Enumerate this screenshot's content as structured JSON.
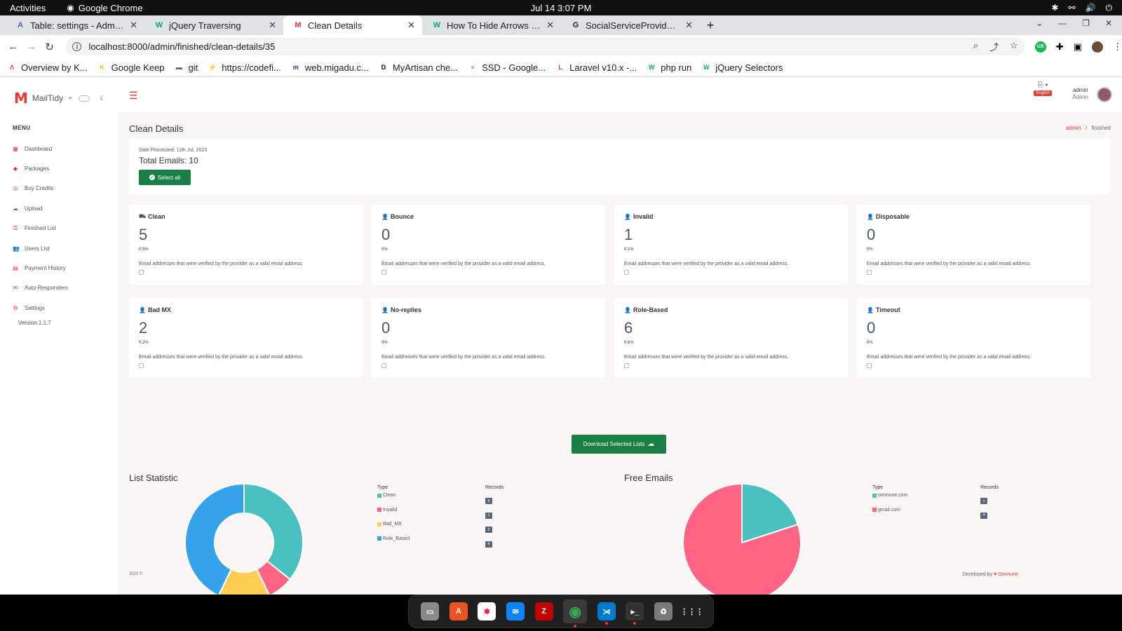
{
  "system": {
    "activities": "Activities",
    "app_name": "Google Chrome",
    "clock": "Jul 14  3:07 PM"
  },
  "tabs": [
    {
      "title": "Table: settings - Adminer",
      "fav": "A",
      "fav_color": "#3b6fb6",
      "active": false
    },
    {
      "title": "jQuery Traversing",
      "fav": "W",
      "fav_color": "#04aa6d",
      "active": false
    },
    {
      "title": "Clean Details",
      "fav": "M",
      "fav_color": "#e8382f",
      "active": true
    },
    {
      "title": "How To Hide Arrows From",
      "fav": "W",
      "fav_color": "#04aa6d",
      "active": false
    },
    {
      "title": "SocialServiceProvider.php",
      "fav": "G",
      "fav_color": "#202124",
      "active": false
    }
  ],
  "url": "localhost:8000/admin/finished/clean-details/35",
  "bookmarks": [
    {
      "label": "Overview by K...",
      "ic": "Λ",
      "color": "#e8382f"
    },
    {
      "label": "Google Keep",
      "ic": "K",
      "color": "#fbbc04"
    },
    {
      "label": "git",
      "ic": "▬",
      "color": "#5f6368"
    },
    {
      "label": "https://codefi...",
      "ic": "⚡",
      "color": "#6c5ce7"
    },
    {
      "label": "web.migadu.c...",
      "ic": "m",
      "color": "#1f3a93"
    },
    {
      "label": "MyArtisan che...",
      "ic": "D",
      "color": "#000000"
    },
    {
      "label": "SSD - Google...",
      "ic": "≡",
      "color": "#4285f4"
    },
    {
      "label": "Laravel v10.x -...",
      "ic": "L",
      "color": "#c0392b"
    },
    {
      "label": "php run",
      "ic": "W",
      "color": "#04aa6d"
    },
    {
      "label": "jQuery Selectors",
      "ic": "W",
      "color": "#04aa6d"
    }
  ],
  "brand": {
    "name": "MailTidy"
  },
  "menu": {
    "heading": "MENU",
    "items": [
      {
        "label": "Dashboard",
        "icon": "▦"
      },
      {
        "label": "Packages",
        "icon": "◆"
      },
      {
        "label": "Buy Credits",
        "icon": "◎"
      },
      {
        "label": "Upload",
        "icon": "☁"
      },
      {
        "label": "Finished List",
        "icon": "☰"
      },
      {
        "label": "Users List",
        "icon": "👥"
      },
      {
        "label": "Payment History",
        "icon": "▤"
      },
      {
        "label": "Auto Responders",
        "icon": "✉"
      },
      {
        "label": "Settings",
        "icon": "⚙"
      }
    ],
    "version": "Version:1.1.7"
  },
  "header": {
    "lang_badge": "English",
    "user_name": "admin",
    "user_role": "Admin"
  },
  "page": {
    "title": "Clean Details",
    "breadcrumb_1": "admin",
    "breadcrumb_sep": "/",
    "breadcrumb_2": "finished",
    "date_processed": "Date Processed: 11th Jul, 2023",
    "total_emails": "Total Emails: 10",
    "select_all": "Select all",
    "download_label": "Download Selected Lists"
  },
  "stats": [
    {
      "name": "Clean",
      "icon": "⛟",
      "count": "5",
      "pct": "0.5%",
      "desc": "Email addresses that were verified by the provider as a valid email address."
    },
    {
      "name": "Bounce",
      "icon": "👤",
      "count": "0",
      "pct": "0%",
      "desc": "Email addresses that were verified by the provider as a valid email address."
    },
    {
      "name": "Invalid",
      "icon": "👤",
      "count": "1",
      "pct": "0.1%",
      "desc": "Email addresses that were verified by the provider as a valid email address."
    },
    {
      "name": "Disposable",
      "icon": "👤",
      "count": "0",
      "pct": "0%",
      "desc": "Email addresses that were verified by the provider as a valid email address."
    },
    {
      "name": "Bad MX",
      "icon": "👤",
      "count": "2",
      "pct": "0.2%",
      "desc": "Email addresses that were verified by the provider as a valid email address."
    },
    {
      "name": "No-replies",
      "icon": "👤",
      "count": "0",
      "pct": "0%",
      "desc": "Email addresses that were verified by the provider as a valid email address."
    },
    {
      "name": "Role-Based",
      "icon": "👤",
      "count": "6",
      "pct": "0.6%",
      "desc": "Email addresses that were verified by the provider as a valid email address."
    },
    {
      "name": "Timeout",
      "icon": "👤",
      "count": "0",
      "pct": "0%",
      "desc": "Email addresses that were verified by the provider as a valid email address."
    }
  ],
  "chart_data": [
    {
      "type": "pie",
      "title": "List Statistic",
      "legend_type": "Type",
      "legend_records": "Records",
      "categories": [
        "Clean",
        "Invalid",
        "Bad_MX",
        "Role_Based"
      ],
      "values": [
        5,
        1,
        2,
        6
      ],
      "colors": [
        "#4bc0c0",
        "#ff6384",
        "#ffcd56",
        "#36a2eb"
      ],
      "donut": true
    },
    {
      "type": "pie",
      "title": "Free Emails",
      "legend_type": "Type",
      "legend_records": "Records",
      "categories": [
        "ommune.com",
        "gmail.com"
      ],
      "values": [
        1,
        4
      ],
      "colors": [
        "#4bc0c0",
        "#ff6384"
      ],
      "donut": false
    }
  ],
  "footer": {
    "copyright": "2023 ©",
    "developed_by": "Developed by",
    "brand": "Ommune"
  },
  "dock": [
    {
      "name": "files",
      "ic": "▭",
      "color": "#8a8a8a"
    },
    {
      "name": "software",
      "ic": "A",
      "color": "#e95420"
    },
    {
      "name": "slack",
      "ic": "✱",
      "color": "#ffffff"
    },
    {
      "name": "thunderbird",
      "ic": "✉",
      "color": "#0a84ff"
    },
    {
      "name": "filezilla",
      "ic": "Z",
      "color": "#bf0000"
    },
    {
      "name": "chrome",
      "ic": "◉",
      "color": "#34a853"
    },
    {
      "name": "vscode",
      "ic": "⋊",
      "color": "#007acc"
    },
    {
      "name": "terminal",
      "ic": "▸_",
      "color": "#333333"
    },
    {
      "name": "trash",
      "ic": "♻",
      "color": "#7a7a7a"
    },
    {
      "name": "app-grid",
      "ic": "⋮⋮⋮",
      "color": "#202020"
    }
  ]
}
